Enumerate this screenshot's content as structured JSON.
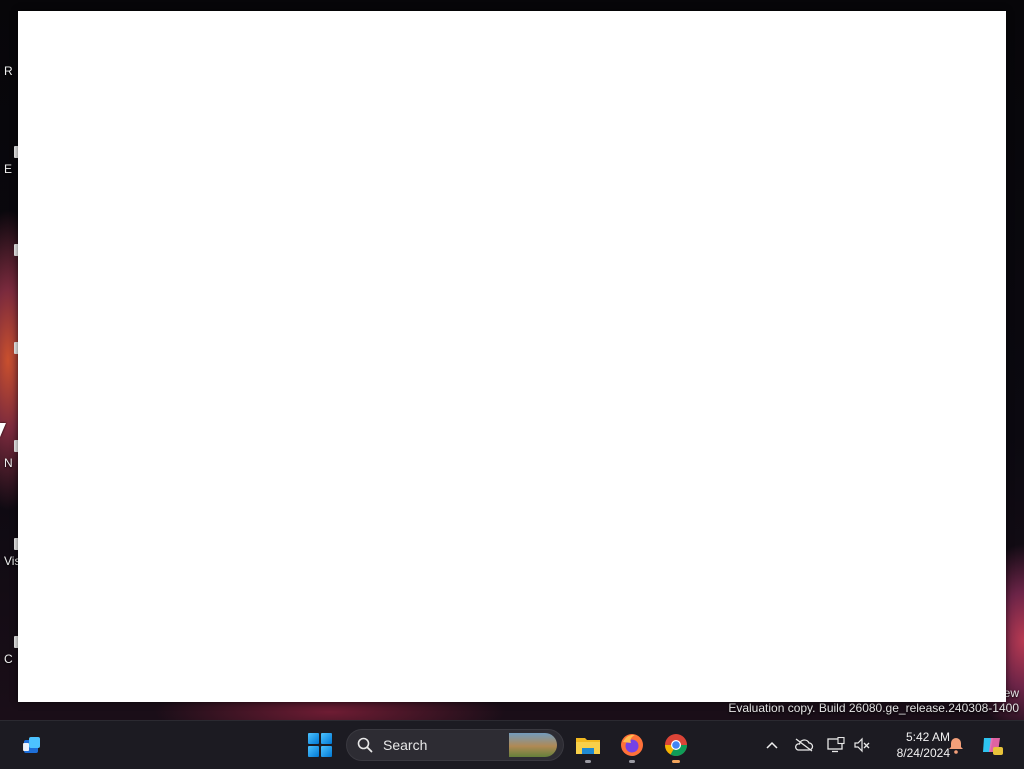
{
  "desktop": {
    "icons": [
      {
        "label": "R",
        "icon": "recycle-bin-icon"
      },
      {
        "label": "E",
        "icon": "edge-icon"
      },
      {
        "label": "",
        "icon": "app-icon"
      },
      {
        "label": "",
        "icon": "app-icon"
      },
      {
        "label": "N",
        "icon": "app-icon"
      },
      {
        "label": "Vis",
        "icon": "visual-studio-icon"
      },
      {
        "label": "C",
        "icon": "app-icon"
      }
    ],
    "watermark_line1": "ew",
    "watermark_line2": "Evaluation copy. Build 26080.ge_release.240308-1400"
  },
  "taskbar": {
    "search_label": "Search",
    "apps": [
      {
        "name": "File Explorer",
        "icon": "folder-icon"
      },
      {
        "name": "Firefox",
        "icon": "firefox-icon"
      },
      {
        "name": "Chrome",
        "icon": "chrome-icon"
      }
    ],
    "clock": {
      "time": "5:42 AM",
      "date": "8/24/2024"
    },
    "colors": {
      "taskbar_bg": "#1c1b22",
      "accent": "#0078d4",
      "notification": "#f4a07a"
    }
  }
}
